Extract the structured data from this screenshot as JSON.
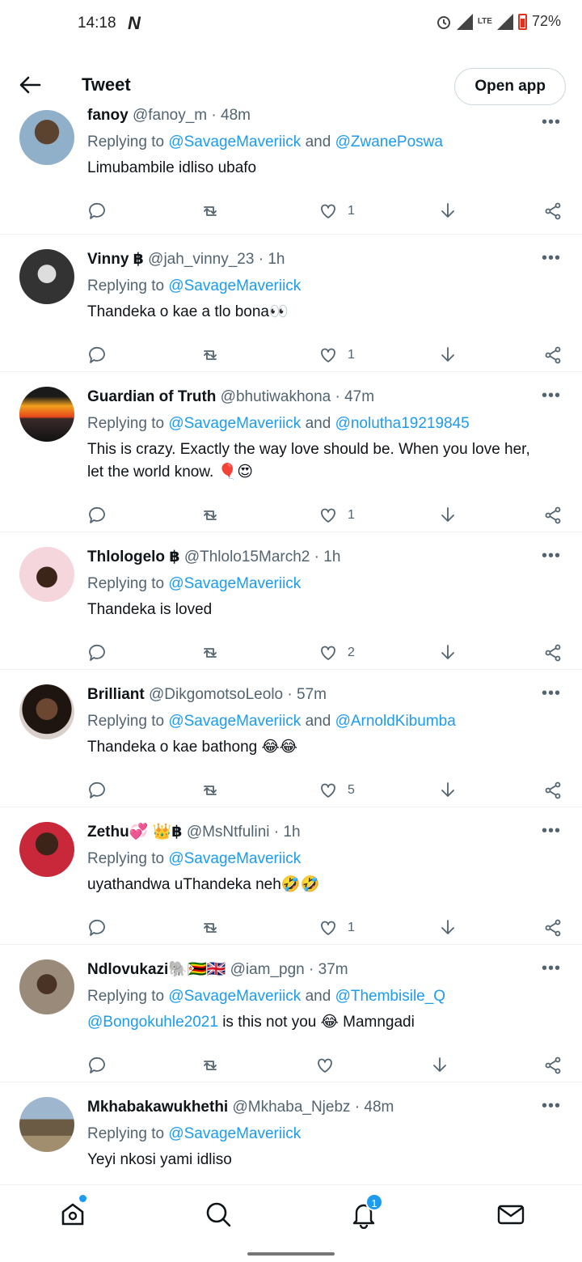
{
  "status_bar": {
    "time": "14:18",
    "carrier_logo": "N",
    "network": "LTE",
    "battery": "72%"
  },
  "header": {
    "title": "Tweet",
    "open_app_label": "Open app"
  },
  "replies": [
    {
      "name": "fanoy",
      "handle": "@fanoy_m",
      "time": "48m",
      "replying_prefix": "Replying to",
      "replying_to": [
        "@SavageMaveriick",
        "@ZwanePoswa"
      ],
      "text": "Limubambile idliso ubafo",
      "likes": "1"
    },
    {
      "name": "Vinny ฿",
      "handle": "@jah_vinny_23",
      "time": "1h",
      "replying_prefix": "Replying to",
      "replying_to": [
        "@SavageMaveriick"
      ],
      "text": "Thandeka o kae a tlo bona👀",
      "likes": "1"
    },
    {
      "name": "Guardian of Truth",
      "handle": "@bhutiwakhona",
      "time": "47m",
      "replying_prefix": "Replying to",
      "replying_to": [
        "@SavageMaveriick",
        "@nolutha19219845"
      ],
      "text": "This is crazy. Exactly the way love should be. When you love her, let the world know.  🎈😍",
      "likes": "1"
    },
    {
      "name": "Thlologelo  ฿",
      "handle": "@Thlolo15March2",
      "time": "1h",
      "replying_prefix": "Replying to",
      "replying_to": [
        "@SavageMaveriick"
      ],
      "text": "Thandeka is loved",
      "likes": "2"
    },
    {
      "name": "Brilliant",
      "handle": "@DikgomotsoLeolo",
      "time": "57m",
      "replying_prefix": "Replying to",
      "replying_to": [
        "@SavageMaveriick",
        "@ArnoldKibumba"
      ],
      "text": "Thandeka o kae bathong 😂😂",
      "likes": "5"
    },
    {
      "name": "Zethu💞 👑฿",
      "handle": "@MsNtfulini",
      "time": "1h",
      "replying_prefix": "Replying to",
      "replying_to": [
        "@SavageMaveriick"
      ],
      "text": "uyathandwa uThandeka neh🤣🤣",
      "likes": "1"
    },
    {
      "name": "Ndlovukazi🐘🇿🇼🇬🇧",
      "handle": "@iam_pgn",
      "time": "37m",
      "replying_prefix": "Replying to",
      "replying_to": [
        "@SavageMaveriick",
        "@Thembisile_Q"
      ],
      "text_mention": "@Bongokuhle2021",
      "text": " is this not you 😂 Mamngadi",
      "likes": ""
    },
    {
      "name": "Mkhabakawukhethi",
      "handle": "@Mkhaba_Njebz",
      "time": "48m",
      "replying_prefix": "Replying to",
      "replying_to": [
        "@SavageMaveriick"
      ],
      "text": "Yeyi nkosi yami idliso",
      "likes": ""
    }
  ],
  "bottom_nav": {
    "notification_count": "1"
  },
  "colors": {
    "accent": "#1d9bf0",
    "text": "#0f1419",
    "muted": "#536471"
  }
}
